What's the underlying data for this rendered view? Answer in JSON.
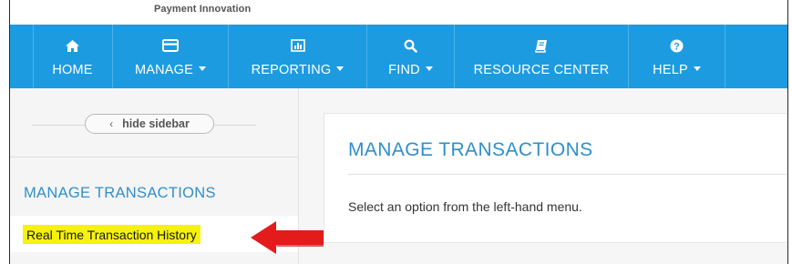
{
  "brand": {
    "tagline": "Payment Innovation"
  },
  "colors": {
    "nav_bg": "#1d9be1",
    "accent_text": "#2f8fca",
    "highlight": "#f6f20c",
    "arrow": "#e41b1b"
  },
  "nav": {
    "items": [
      {
        "label": "HOME",
        "icon": "home-icon",
        "has_caret": false
      },
      {
        "label": "MANAGE",
        "icon": "card-icon",
        "has_caret": true
      },
      {
        "label": "REPORTING",
        "icon": "bar-chart-icon",
        "has_caret": true
      },
      {
        "label": "FIND",
        "icon": "search-icon",
        "has_caret": true
      },
      {
        "label": "RESOURCE CENTER",
        "icon": "book-icon",
        "has_caret": false
      },
      {
        "label": "HELP",
        "icon": "question-circle-icon",
        "has_caret": true
      }
    ]
  },
  "sidebar": {
    "toggle_label": "hide sidebar",
    "heading": "MANAGE TRANSACTIONS",
    "links": [
      {
        "label": "Real Time Transaction History",
        "highlighted": true
      }
    ]
  },
  "main": {
    "title": "MANAGE TRANSACTIONS",
    "message": "Select an option from the left-hand menu."
  }
}
